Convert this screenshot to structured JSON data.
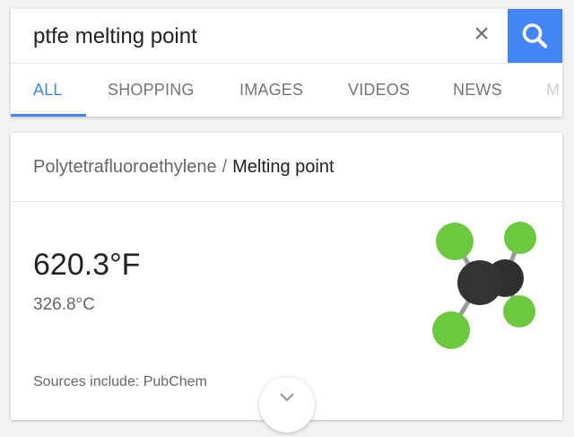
{
  "search": {
    "query": "ptfe melting point"
  },
  "tabs": [
    {
      "label": "ALL"
    },
    {
      "label": "SHOPPING"
    },
    {
      "label": "IMAGES"
    },
    {
      "label": "VIDEOS"
    },
    {
      "label": "NEWS"
    },
    {
      "label": "M"
    }
  ],
  "result": {
    "entity": "Polytetrafluoroethylene",
    "separator": "/",
    "attribute": "Melting point",
    "value_primary": "620.3°F",
    "value_secondary": "326.8°C",
    "sources": "Sources include: PubChem"
  },
  "colors": {
    "accent": "#4285f4",
    "fluorine": "#66c43a",
    "carbon": "#333333"
  },
  "icons": [
    "clear-icon",
    "search-icon",
    "molecule-image",
    "expand-chevron-icon"
  ]
}
